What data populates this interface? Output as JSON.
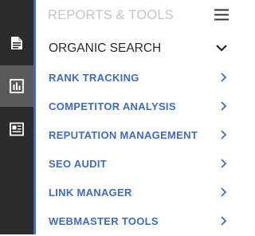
{
  "rail": {
    "items": [
      {
        "icon": "document-icon",
        "active": false
      },
      {
        "icon": "bar-chart-icon",
        "active": true
      },
      {
        "icon": "newspaper-icon",
        "active": false
      }
    ]
  },
  "panel": {
    "title": "REPORTS & TOOLS",
    "menu_icon": "hamburger-icon"
  },
  "section": {
    "title": "ORGANIC SEARCH",
    "expanded": true,
    "items": [
      {
        "label": "RANK TRACKING"
      },
      {
        "label": "COMPETITOR ANALYSIS"
      },
      {
        "label": "REPUTATION MANAGEMENT"
      },
      {
        "label": "SEO AUDIT"
      },
      {
        "label": "LINK MANAGER"
      },
      {
        "label": "WEBMASTER TOOLS"
      }
    ]
  },
  "colors": {
    "accent": "#3f6cbf",
    "rail_bg": "#2b2b2b",
    "rail_active": "#5a5a5a",
    "muted_title": "#c4c4c4"
  }
}
